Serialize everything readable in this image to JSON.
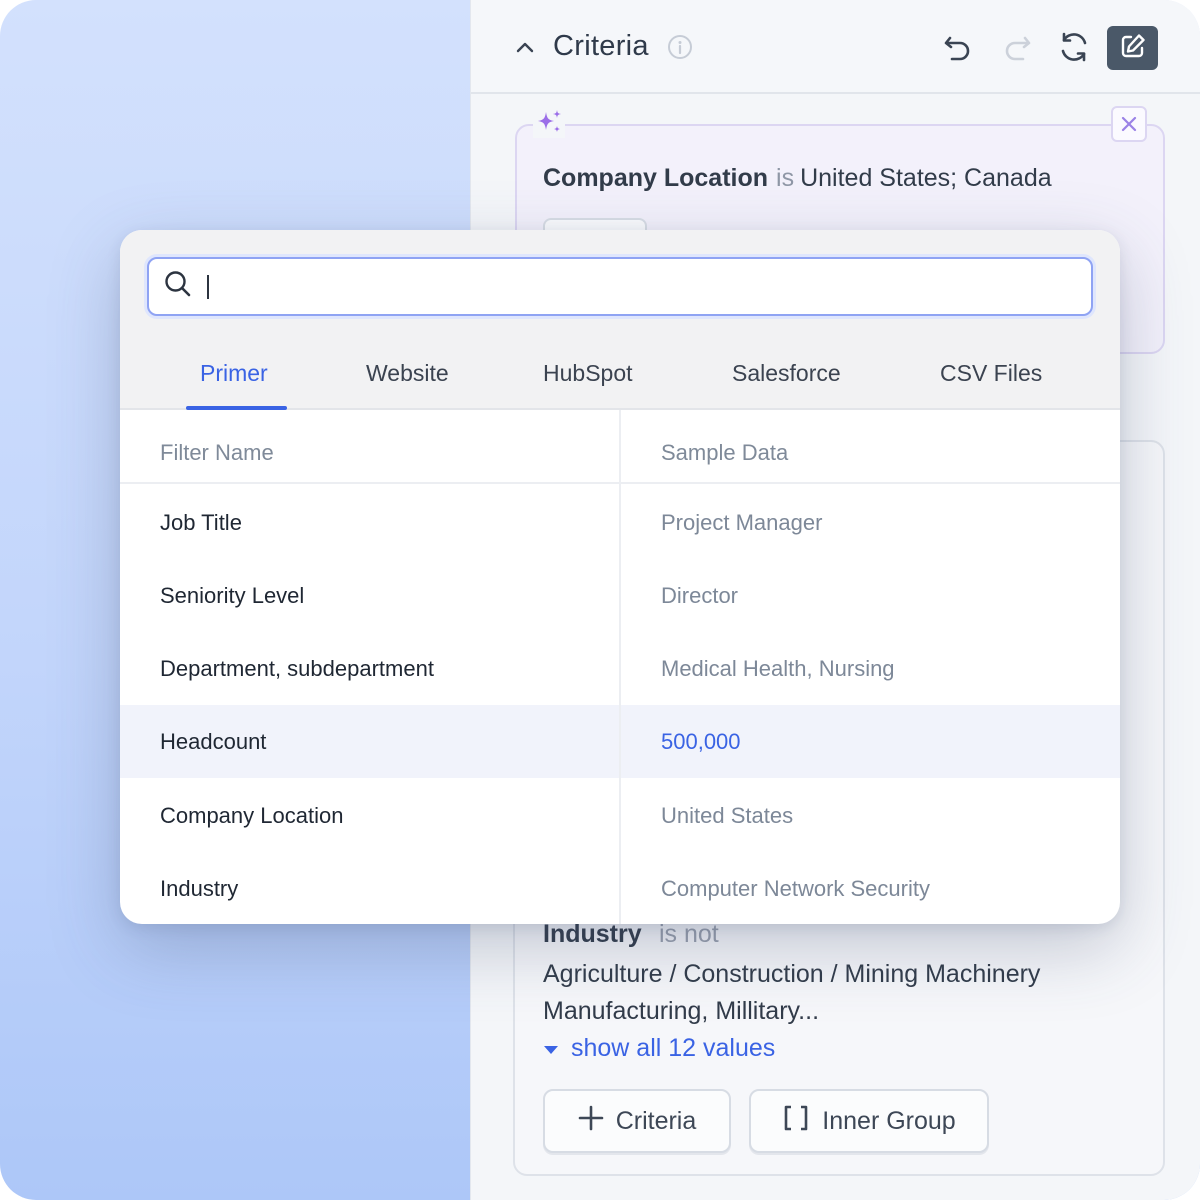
{
  "criteria_panel": {
    "title": "Criteria",
    "rule1": {
      "field": "Company Location",
      "operator": "is",
      "value": "United States; Canada"
    },
    "rule2": {
      "field": "Industry",
      "operator": "is not",
      "value": "Agriculture / Construction / Mining Machinery Manufacturing, Millitary...",
      "show_all": "show all 12 values"
    },
    "buttons": {
      "criteria": "Criteria",
      "inner_group": "Inner Group"
    }
  },
  "popup": {
    "search": {
      "value": "",
      "placeholder": ""
    },
    "tabs": [
      {
        "label": "Primer",
        "active": true
      },
      {
        "label": "Website",
        "active": false
      },
      {
        "label": "HubSpot",
        "active": false
      },
      {
        "label": "Salesforce",
        "active": false
      },
      {
        "label": "CSV Files",
        "active": false
      }
    ],
    "columns": {
      "name": "Filter Name",
      "sample": "Sample Data"
    },
    "rows": [
      {
        "name": "Job Title",
        "sample": "Project Manager"
      },
      {
        "name": "Seniority Level",
        "sample": "Director"
      },
      {
        "name": "Department, subdepartment",
        "sample": "Medical Health, Nursing"
      },
      {
        "name": "Headcount",
        "sample": "500,000",
        "highlighted": true
      },
      {
        "name": "Company Location",
        "sample": "United States"
      },
      {
        "name": "Industry",
        "sample": "Computer Network Security"
      }
    ]
  },
  "icons": [
    "chevron-up-icon",
    "info-icon",
    "undo-icon",
    "redo-icon",
    "refresh-icon",
    "edit-icon",
    "sparkle-icon",
    "close-icon",
    "caret-down-icon",
    "plus-icon",
    "brackets-icon",
    "search-icon"
  ],
  "colors": {
    "accent": "#3a63e4",
    "ai_purple": "#9b6ee8",
    "background_blue": "#c2d5fb",
    "edit_button": "#4a5868"
  }
}
